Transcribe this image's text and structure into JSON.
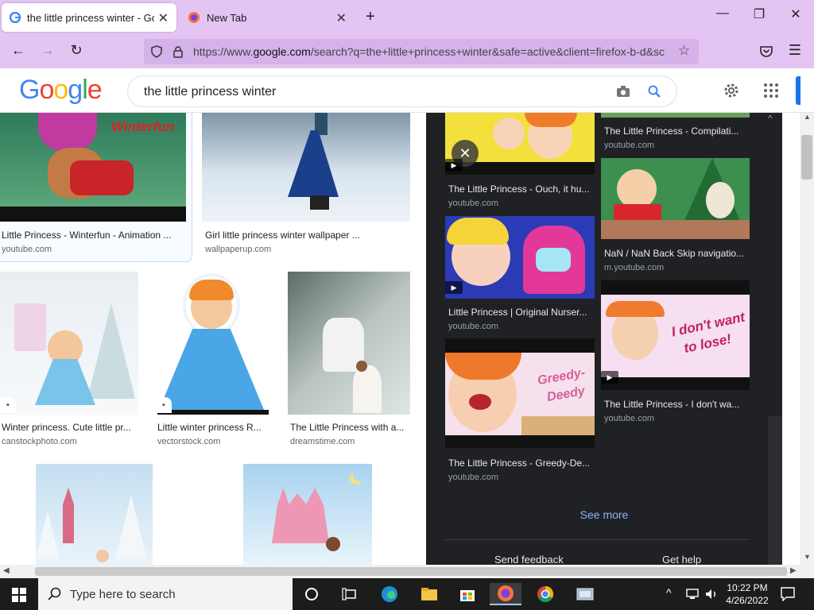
{
  "browser": {
    "tabs": [
      {
        "title": "the little princess winter - Goog"
      },
      {
        "title": "New Tab"
      }
    ],
    "url_prefix": "https://www.",
    "url_domain": "google.com",
    "url_rest": "/search?q=the+little+princess+winter&safe=active&client=firefox-b-d&sc"
  },
  "google": {
    "logo": "Google",
    "query": "the little princess winter"
  },
  "results": [
    {
      "caption": "Little Princess - Winterfun - Animation ...",
      "source": "youtube.com",
      "overlay": "Winterfun"
    },
    {
      "caption": "Girl little princess winter wallpaper ...",
      "source": "wallpaperup.com"
    },
    {
      "caption": "Winter princess. Cute little pr...",
      "source": "canstockphoto.com"
    },
    {
      "caption": "Little winter princess R...",
      "source": "vectorstock.com"
    },
    {
      "caption": "The Little Princess with a...",
      "source": "dreamstime.com"
    }
  ],
  "panel": {
    "videos": [
      {
        "caption": "The Little Princess - Ouch, it hu...",
        "source": "youtube.com"
      },
      {
        "caption": "The Little Princess - Compilati...",
        "source": "youtube.com"
      },
      {
        "caption": "NaN / NaN Back Skip navigatio...",
        "source": "m.youtube.com"
      },
      {
        "caption": "Little Princess | Original Nurser...",
        "source": "youtube.com"
      },
      {
        "caption": "The Little Princess - I don't wa...",
        "source": "youtube.com",
        "overlay_line1": "I don't want",
        "overlay_line2": "to lose!"
      },
      {
        "caption": "The Little Princess - Greedy-De...",
        "source": "youtube.com",
        "overlay_line1": "Greedy-",
        "overlay_line2": "Deedy"
      }
    ],
    "see_more": "See more",
    "send_feedback": "Send feedback",
    "get_help": "Get help"
  },
  "taskbar": {
    "search_placeholder": "Type here to search",
    "time": "10:22 PM",
    "date": "4/26/2022"
  },
  "colors": {
    "browser_chrome": "#e3c4f2",
    "panel_bg": "#202124",
    "link_blue": "#8ab4f8"
  }
}
